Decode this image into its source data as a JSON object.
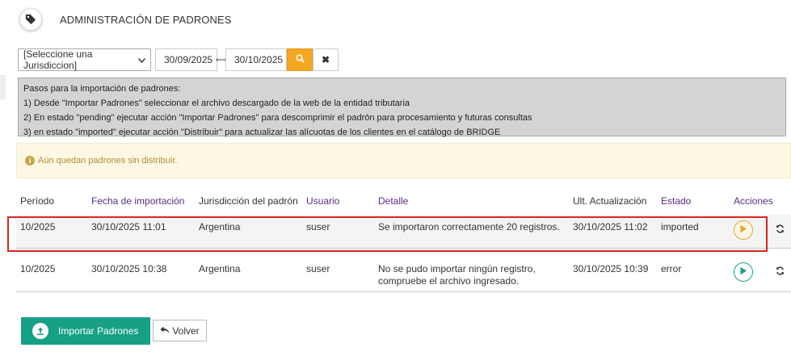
{
  "header": {
    "title": "ADMINISTRACIÓN DE PADRONES",
    "icon": "tag-icon"
  },
  "filters": {
    "jurisdiction": {
      "selected": "[Seleccione una Jurisdiccion]"
    },
    "date_from": "30/09/2025",
    "date_to": "30/10/2025",
    "range_separator": "⟷",
    "clear_label": "✖"
  },
  "instructions": {
    "heading": "Pasos para la importación de padrones:",
    "steps": [
      "1) Desde \"Importar Padrones\" seleccionar el archivo descargado de la web de la entidad tributaria",
      "2) En estado \"pending\" ejecutar acción \"Importar Padrones\" para descomprimir el padrón para procesamiento y futuras consultas",
      "3) en estado \"imported\" ejecutar acción \"Distribuir\" para actualizar las alícuotas de los clientes en el catálogo de BRIDGE"
    ]
  },
  "alert": {
    "message": "Aún quedan padrones sin distribuir."
  },
  "table": {
    "columns": [
      "Período",
      "Fecha de importación",
      "Jurisdicción del padrón",
      "Usuario",
      "Detalle",
      "Ult. Actualización",
      "Estado",
      "Acciones"
    ],
    "rows": [
      {
        "periodo": "10/2025",
        "fecha": "30/10/2025 11:01",
        "jurisdiccion": "Argentina",
        "usuario": "suser",
        "detalle": "Se importaron correctamente 20 registros.",
        "actualizacion": "30/10/2025 11:02",
        "estado": "imported"
      },
      {
        "periodo": "10/2025",
        "fecha": "30/10/2025 10:38",
        "jurisdiccion": "Argentina",
        "usuario": "suser",
        "detalle": "No se pudo importar ningún registro, compruebe el archivo ingresado.",
        "actualizacion": "30/10/2025 10:39",
        "estado": "error"
      }
    ]
  },
  "buttons": {
    "import_label": "Importar Padrones",
    "back_label": "Volver"
  },
  "colors": {
    "accent_green": "#16a085",
    "accent_amber": "#f5a623",
    "highlight_red": "#d9261c",
    "header_purple": "#5b2a86"
  }
}
